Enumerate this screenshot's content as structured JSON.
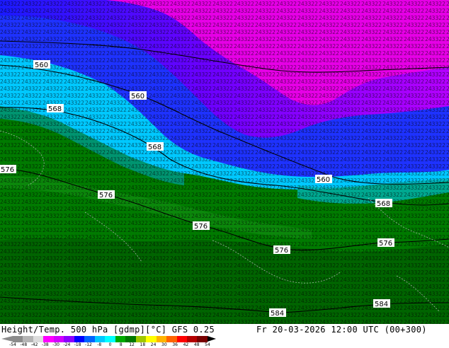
{
  "title": "Height/Temp. 500 hPa [gdmp][°C] GFS 0.25",
  "valid_time": "Fr 20-03-2026 12:00 UTC (00+300)",
  "contour_labels": [
    "560",
    "560",
    "568",
    "568",
    "576",
    "576",
    "576",
    "560",
    "568",
    "576",
    "576",
    "584",
    "584"
  ],
  "colorbar": {
    "ticks": [
      "-54",
      "-48",
      "-42",
      "-38",
      "-30",
      "-24",
      "-18",
      "-12",
      "-8",
      "0",
      "8",
      "12",
      "18",
      "24",
      "30",
      "36",
      "42",
      "48",
      "54"
    ],
    "colors": [
      "#8c8c8c",
      "#b4b4b4",
      "#dcdcdc",
      "#ff00ff",
      "#d200ff",
      "#8c00ff",
      "#0000ff",
      "#0064ff",
      "#00c8ff",
      "#00ffff",
      "#00aa00",
      "#007800",
      "#a0c800",
      "#ffff00",
      "#ffb400",
      "#ff6400",
      "#ff0000",
      "#b40000",
      "#780000"
    ]
  },
  "fields": {
    "magenta": "#e000e0",
    "violet": "#9a00ff",
    "blue": "#1a1aff",
    "cyan": "#00c8ff",
    "teal": "#00b4b4",
    "green_dark": "#006e00",
    "green": "#0a8a0a"
  }
}
